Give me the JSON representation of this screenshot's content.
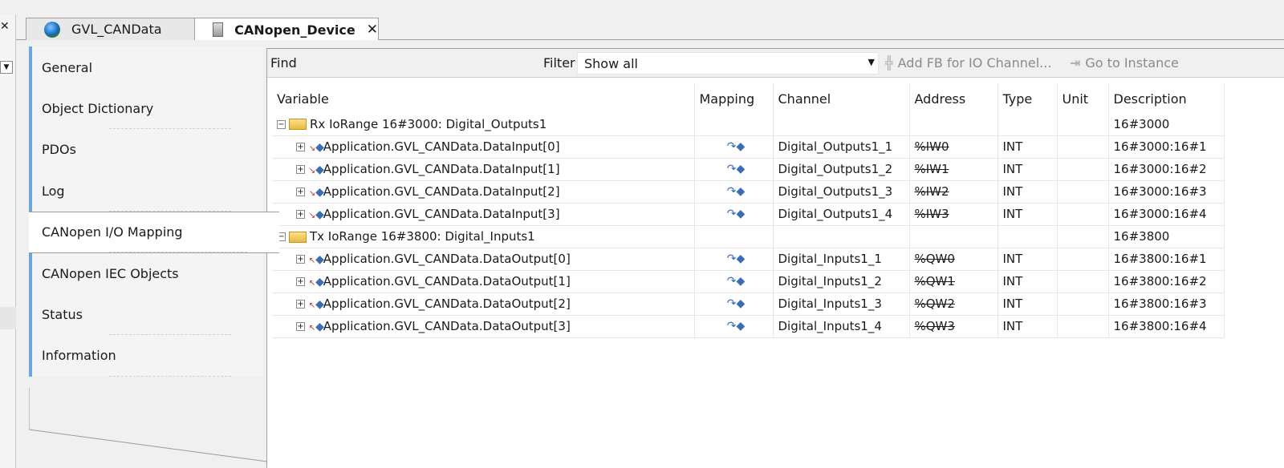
{
  "tabs": [
    {
      "label": "GVL_CANData",
      "icon": "globe-icon"
    },
    {
      "label": "CANopen_Device",
      "icon": "device-icon",
      "active": true
    }
  ],
  "close_glyph": "✕",
  "sidebar": {
    "items": [
      {
        "label": "General"
      },
      {
        "label": "Object Dictionary"
      },
      {
        "label": "PDOs"
      },
      {
        "label": "Log"
      },
      {
        "label": "CANopen I/O Mapping",
        "active": true
      },
      {
        "label": "CANopen IEC Objects"
      },
      {
        "label": "Status"
      },
      {
        "label": "Information"
      }
    ]
  },
  "toolbar": {
    "find_label": "Find",
    "find_value": "",
    "filter_label": "Filter",
    "filter_value": "Show all",
    "add_fb_label": "Add FB for IO Channel...",
    "go_instance_label": "Go to Instance"
  },
  "table": {
    "columns": [
      "Variable",
      "Mapping",
      "Channel",
      "Address",
      "Type",
      "Unit",
      "Description"
    ],
    "groups": [
      {
        "label": "Rx IoRange 16#3000: Digital_Outputs1",
        "description": "16#3000",
        "rows": [
          {
            "variable": "Application.GVL_CANData.DataInput[0]",
            "channel": "Digital_Outputs1_1",
            "address": "%IW0",
            "type": "INT",
            "unit": "",
            "description": "16#3000:16#1"
          },
          {
            "variable": "Application.GVL_CANData.DataInput[1]",
            "channel": "Digital_Outputs1_2",
            "address": "%IW1",
            "type": "INT",
            "unit": "",
            "description": "16#3000:16#2"
          },
          {
            "variable": "Application.GVL_CANData.DataInput[2]",
            "channel": "Digital_Outputs1_3",
            "address": "%IW2",
            "type": "INT",
            "unit": "",
            "description": "16#3000:16#3"
          },
          {
            "variable": "Application.GVL_CANData.DataInput[3]",
            "channel": "Digital_Outputs1_4",
            "address": "%IW3",
            "type": "INT",
            "unit": "",
            "description": "16#3000:16#4"
          }
        ]
      },
      {
        "label": "Tx IoRange 16#3800: Digital_Inputs1",
        "description": "16#3800",
        "rows": [
          {
            "variable": "Application.GVL_CANData.DataOutput[0]",
            "channel": "Digital_Inputs1_1",
            "address": "%QW0",
            "type": "INT",
            "unit": "",
            "description": "16#3800:16#1"
          },
          {
            "variable": "Application.GVL_CANData.DataOutput[1]",
            "channel": "Digital_Inputs1_2",
            "address": "%QW1",
            "type": "INT",
            "unit": "",
            "description": "16#3800:16#2"
          },
          {
            "variable": "Application.GVL_CANData.DataOutput[2]",
            "channel": "Digital_Inputs1_3",
            "address": "%QW2",
            "type": "INT",
            "unit": "",
            "description": "16#3800:16#3"
          },
          {
            "variable": "Application.GVL_CANData.DataOutput[3]",
            "channel": "Digital_Inputs1_4",
            "address": "%QW3",
            "type": "INT",
            "unit": "",
            "description": "16#3800:16#4"
          }
        ]
      }
    ]
  },
  "colors": {
    "accent": "#6aa6dc",
    "folder": "#e8b940",
    "mapping_icon": "#3a6db8"
  }
}
